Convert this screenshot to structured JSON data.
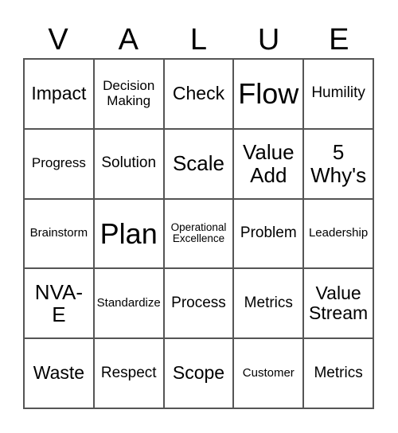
{
  "title_letters": [
    "V",
    "A",
    "L",
    "U",
    "E"
  ],
  "cells": [
    [
      "Impact",
      "Decision Making",
      "Check",
      "Flow",
      "Humility"
    ],
    [
      "Progress",
      "Solution",
      "Scale",
      "Value Add",
      "5 Why's"
    ],
    [
      "Brainstorm",
      "Plan",
      "Operational Excellence",
      "Problem",
      "Leadership"
    ],
    [
      "NVA-E",
      "Standardize",
      "Process",
      "Metrics",
      "Value Stream"
    ],
    [
      "Waste",
      "Respect",
      "Scope",
      "Customer",
      "Metrics"
    ]
  ]
}
